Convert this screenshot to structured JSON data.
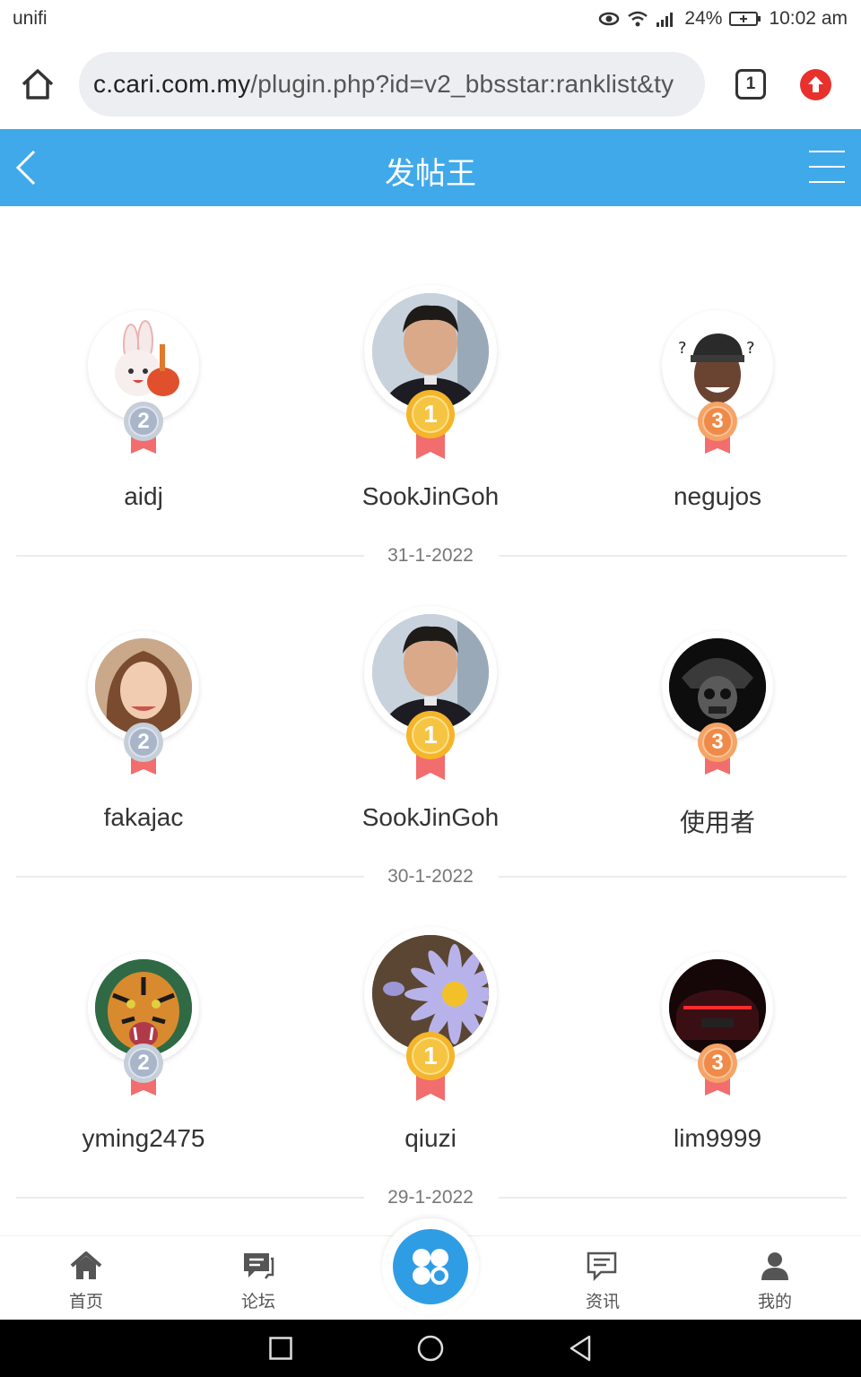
{
  "status_bar": {
    "carrier": "unifi",
    "battery": "24%",
    "time": "10:02 am"
  },
  "browser": {
    "url_domain": "c.cari.com.my",
    "url_path": "/plugin.php?id=v2_bbsstar:ranklist&ty",
    "tab_count": "1"
  },
  "header": {
    "title": "发帖王"
  },
  "ranking_days": [
    {
      "date": "31-1-2022",
      "first": {
        "rank": "1",
        "name": "SookJinGoh"
      },
      "second": {
        "rank": "2",
        "name": "aidj"
      },
      "third": {
        "rank": "3",
        "name": "negujos"
      }
    },
    {
      "date": "30-1-2022",
      "first": {
        "rank": "1",
        "name": "SookJinGoh"
      },
      "second": {
        "rank": "2",
        "name": "fakajac"
      },
      "third": {
        "rank": "3",
        "name": "使用者"
      }
    },
    {
      "date": "29-1-2022",
      "first": {
        "rank": "1",
        "name": "qiuzi"
      },
      "second": {
        "rank": "2",
        "name": "yming2475"
      },
      "third": {
        "rank": "3",
        "name": "lim9999"
      }
    }
  ],
  "bottom_nav": {
    "home": "首页",
    "forum": "论坛",
    "news": "资讯",
    "mine": "我的"
  },
  "colors": {
    "header_bg": "#40a9ea",
    "gold": "#f4b52a",
    "silver": "#a9b6c9",
    "bronze": "#ef8a48",
    "ribbon": "#f26d6d"
  }
}
